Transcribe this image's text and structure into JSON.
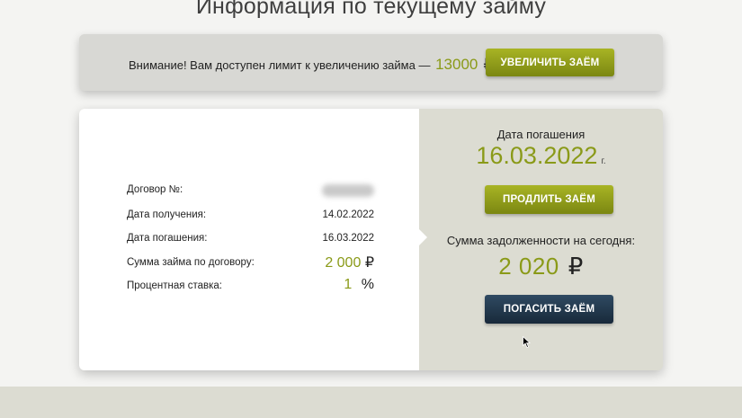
{
  "page": {
    "title": "Информация по текущему займу"
  },
  "banner": {
    "text": "Внимание! Вам доступен лимит к увеличению займа —",
    "amount": "13000",
    "currency": "₽",
    "button_label": "УВЕЛИЧИТЬ ЗАЁМ"
  },
  "details": {
    "rows": [
      {
        "label": "Договор №:",
        "value": ""
      },
      {
        "label": "Дата получения:",
        "value": "14.02.2022"
      },
      {
        "label": "Дата погашения:",
        "value": "16.03.2022"
      },
      {
        "label": "Сумма займа по договору:",
        "value": "2 000",
        "currency": "₽"
      },
      {
        "label": "Процентная ставка:",
        "value": "1",
        "unit": "%"
      }
    ]
  },
  "summary": {
    "due_label": "Дата погашения",
    "due_date": "16.03.2022",
    "due_suffix": "г.",
    "extend_button": "ПРОДЛИТЬ ЗАЁМ",
    "debt_label": "Сумма задолженности на сегодня:",
    "debt_amount": "2 020",
    "debt_currency": "₽",
    "repay_button": "ПОГАСИТЬ ЗАЁМ"
  },
  "colors": {
    "accent_olive": "#8a9a18",
    "button_dark": "#18293a",
    "panel_gray": "#dcdcd2"
  },
  "icons": {
    "cursor": "arrow-cursor-icon"
  }
}
